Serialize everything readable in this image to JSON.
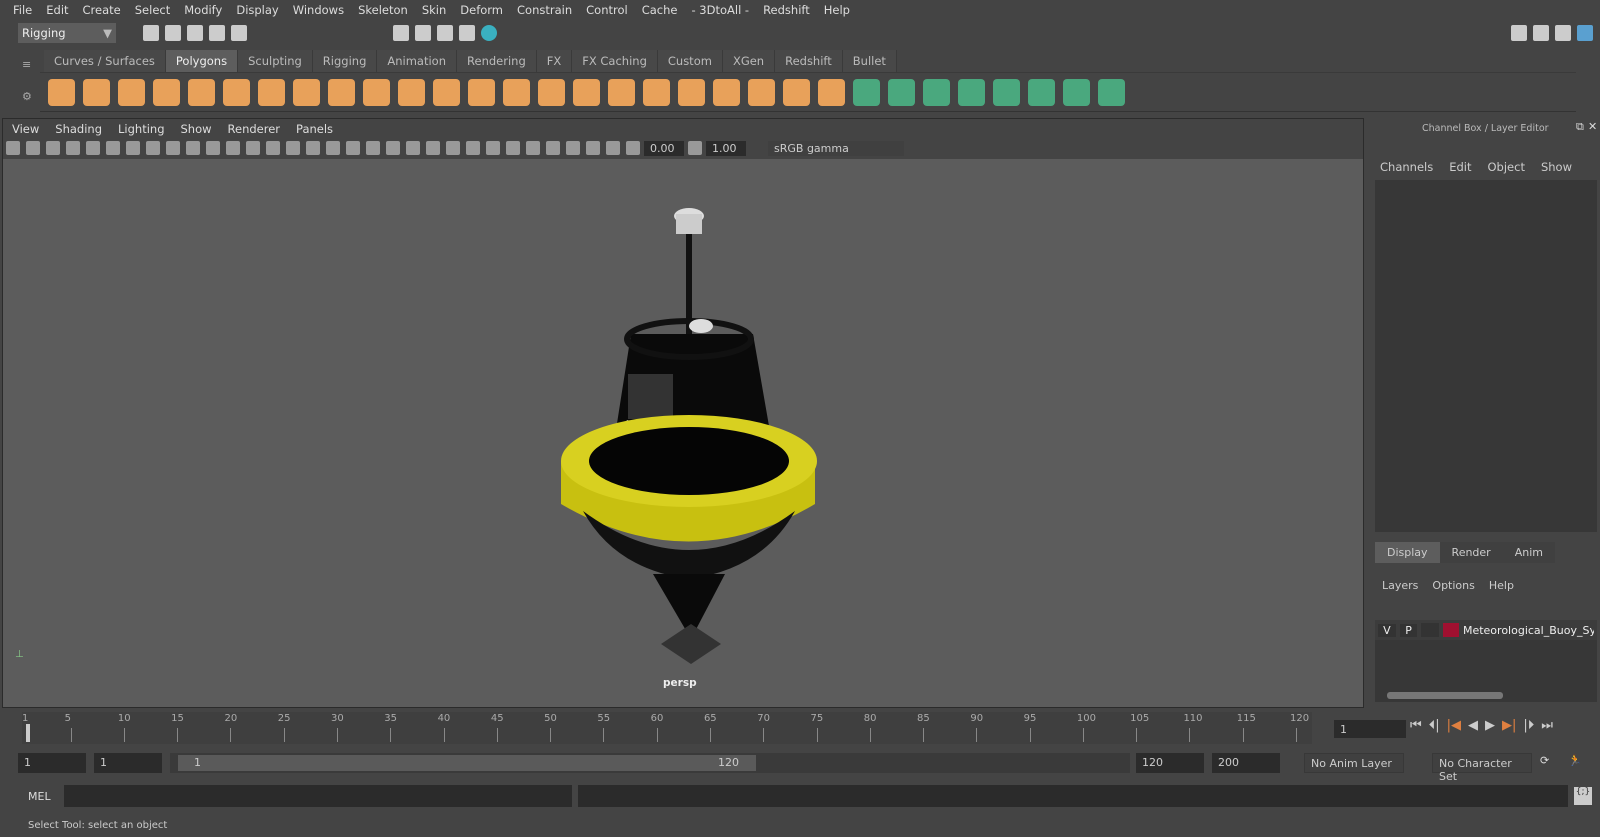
{
  "menu": [
    "File",
    "Edit",
    "Create",
    "Select",
    "Modify",
    "Display",
    "Windows",
    "Skeleton",
    "Skin",
    "Deform",
    "Constrain",
    "Control",
    "Cache",
    "- 3DtoAll -",
    "Redshift",
    "Help"
  ],
  "menuset": "Rigging",
  "shelf_tabs": [
    "Curves / Surfaces",
    "Polygons",
    "Sculpting",
    "Rigging",
    "Animation",
    "Rendering",
    "FX",
    "FX Caching",
    "Custom",
    "XGen",
    "Redshift",
    "Bullet"
  ],
  "active_shelf": "Polygons",
  "viewport": {
    "menu": [
      "View",
      "Shading",
      "Lighting",
      "Show",
      "Renderer",
      "Panels"
    ],
    "exposure": "0.00",
    "gamma": "1.00",
    "colorspace": "sRGB gamma",
    "camera": "persp"
  },
  "channel_box": {
    "title": "Channel Box / Layer Editor",
    "menu": [
      "Channels",
      "Edit",
      "Object",
      "Show"
    ],
    "tabs": [
      "Display",
      "Render",
      "Anim"
    ],
    "active_tab": "Display",
    "layer_menu": [
      "Layers",
      "Options",
      "Help"
    ],
    "layer": {
      "v": "V",
      "p": "P",
      "name": "Meteorological_Buoy_Sy",
      "color": "#a01030"
    }
  },
  "timeline": {
    "ticks": [
      "1",
      "5",
      "10",
      "15",
      "20",
      "25",
      "30",
      "35",
      "40",
      "45",
      "50",
      "55",
      "60",
      "65",
      "70",
      "75",
      "80",
      "85",
      "90",
      "95",
      "100",
      "105",
      "110",
      "115",
      "120"
    ],
    "current": "1"
  },
  "range": {
    "start": "1",
    "anim_start": "1",
    "slider_start": "1",
    "slider_end": "120",
    "end": "120",
    "anim_end": "200",
    "anim_layer": "No Anim Layer",
    "char_set": "No Character Set"
  },
  "cmd": {
    "label": "MEL"
  },
  "status": "Select Tool: select an object"
}
